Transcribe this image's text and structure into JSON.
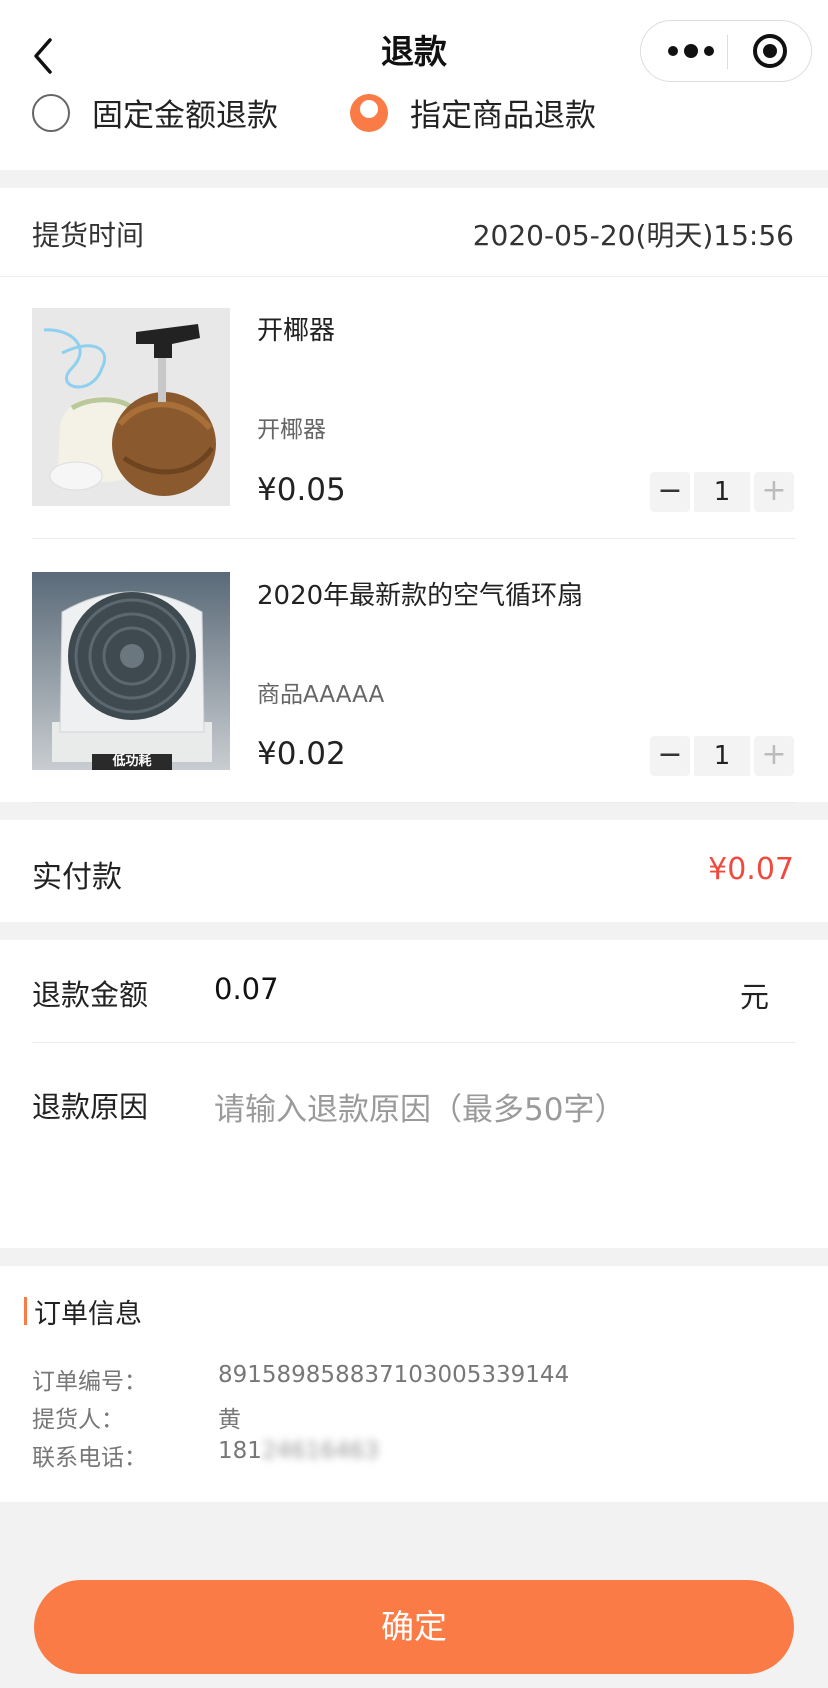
{
  "header": {
    "title": "退款"
  },
  "refund_type": {
    "options": [
      {
        "label": "固定金额退款",
        "selected": false
      },
      {
        "label": "指定商品退款",
        "selected": true
      }
    ]
  },
  "pickup": {
    "label": "提货时间",
    "value": "2020-05-20(明天)15:56"
  },
  "products": [
    {
      "name": "开椰器",
      "spec": "开椰器",
      "price": "¥0.05",
      "quantity": "1",
      "image_icon": "coconut-opener-image"
    },
    {
      "name": "2020年最新款的空气循环扇",
      "spec": "商品AAAAA",
      "price": "¥0.02",
      "quantity": "1",
      "image_icon": "air-circulation-fan-image",
      "image_caption": "低功耗"
    }
  ],
  "stepper": {
    "minus": "−",
    "plus": "+"
  },
  "paid": {
    "label": "实付款",
    "value": "¥0.07"
  },
  "refund_form": {
    "amount_label": "退款金额",
    "amount_value": "0.07",
    "amount_unit": "元",
    "reason_label": "退款原因",
    "reason_placeholder": "请输入退款原因（最多50字）"
  },
  "order_info": {
    "title": "订单信息",
    "rows": [
      {
        "label": "订单编号：",
        "value": "891589858837103005339144"
      },
      {
        "label": "提货人：",
        "value": "黄"
      },
      {
        "label": "联系电话：",
        "value": "181",
        "value_hidden": "24616463"
      }
    ]
  },
  "confirm_button": "确定",
  "colors": {
    "accent": "#fa7b45",
    "price_red": "#f04a3e",
    "background": "#f2f2f2"
  }
}
